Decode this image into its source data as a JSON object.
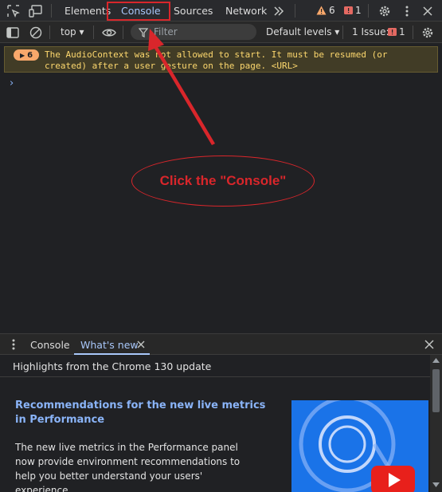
{
  "tabbar": {
    "tabs": [
      {
        "label": "Elements",
        "active": false
      },
      {
        "label": "Console",
        "active": true
      },
      {
        "label": "Sources",
        "active": false
      },
      {
        "label": "Network",
        "active": false
      }
    ],
    "more_tabs_icon": "double-chevron-right-icon",
    "warnings_count": "6",
    "errors_count": "1"
  },
  "toolbar": {
    "context": "top",
    "filter_placeholder": "Filter",
    "levels": "Default levels",
    "issues_label": "1 Issue:",
    "issues_count": "1"
  },
  "console": {
    "messages": [
      {
        "level": "warning",
        "count": "6",
        "text": "The AudioContext was not allowed to start. It must be resumed (or created) after a user gesture on the page. <URL>"
      }
    ],
    "prompt": "›"
  },
  "annotation": {
    "callout": "Click the \"Console\"",
    "color": "#d9262b"
  },
  "drawer": {
    "tabs": [
      {
        "label": "Console",
        "active": false
      },
      {
        "label": "What's new",
        "active": true
      }
    ],
    "highlights": "Highlights from the Chrome 130 update",
    "rec_title": "Recommendations for the new live metrics in Performance",
    "rec_body": "The new live metrics in the Performance panel now provide environment recommendations to help you better understand your users' experience."
  },
  "colors": {
    "accent": "#a8c7fa",
    "warning_bg": "#413c26",
    "warning_text": "#fdd86e",
    "badge": "#f9a86b",
    "error_badge": "#e46962"
  }
}
